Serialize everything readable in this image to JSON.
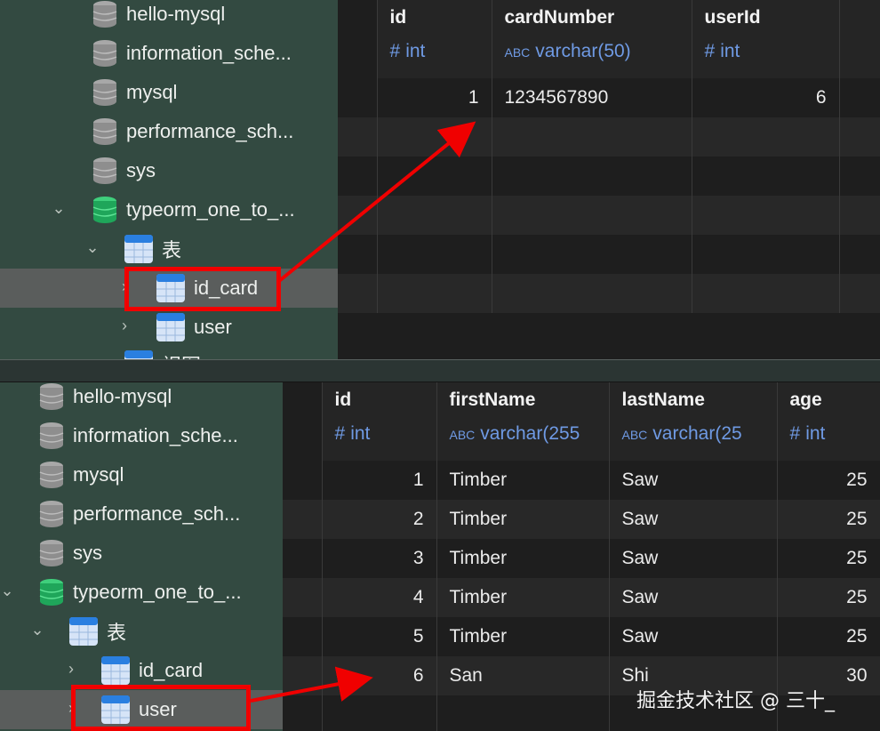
{
  "top": {
    "sidebar": {
      "databases": [
        {
          "name": "hello-mysql"
        },
        {
          "name": "information_sche..."
        },
        {
          "name": "mysql"
        },
        {
          "name": "performance_sch..."
        },
        {
          "name": "sys"
        },
        {
          "name": "typeorm_one_to_..."
        }
      ],
      "tables_folder": "表",
      "tables": [
        "id_card",
        "user"
      ],
      "views_folder": "视图",
      "selected": "id_card"
    },
    "grid": {
      "columns": [
        {
          "name": "id",
          "type": "int",
          "type_symbol": "#"
        },
        {
          "name": "cardNumber",
          "type": "varchar(50)",
          "type_symbol": "ABC"
        },
        {
          "name": "userId",
          "type": "int",
          "type_symbol": "#"
        }
      ],
      "rows": [
        [
          "1",
          "1234567890",
          "6"
        ]
      ]
    }
  },
  "bottom": {
    "sidebar": {
      "databases": [
        {
          "name": "hello-mysql"
        },
        {
          "name": "information_sche..."
        },
        {
          "name": "mysql"
        },
        {
          "name": "performance_sch..."
        },
        {
          "name": "sys"
        },
        {
          "name": "typeorm_one_to_..."
        }
      ],
      "tables_folder": "表",
      "tables": [
        "id_card",
        "user"
      ],
      "selected": "user"
    },
    "grid": {
      "columns": [
        {
          "name": "id",
          "type": "int",
          "type_symbol": "#"
        },
        {
          "name": "firstName",
          "type": "varchar(255",
          "type_symbol": "ABC"
        },
        {
          "name": "lastName",
          "type": "varchar(25",
          "type_symbol": "ABC"
        },
        {
          "name": "age",
          "type": "int",
          "type_symbol": "#"
        }
      ],
      "rows": [
        [
          "1",
          "Timber",
          "Saw",
          "25"
        ],
        [
          "2",
          "Timber",
          "Saw",
          "25"
        ],
        [
          "3",
          "Timber",
          "Saw",
          "25"
        ],
        [
          "4",
          "Timber",
          "Saw",
          "25"
        ],
        [
          "5",
          "Timber",
          "Saw",
          "25"
        ],
        [
          "6",
          "San",
          "Shi",
          "30"
        ]
      ]
    }
  },
  "watermark": "掘金技术社区 @ 三十_",
  "colors": {
    "annotation_red": "#f00000",
    "sidebar_bg": "#334a41",
    "type_blue": "#6f9ae4",
    "db_gray": "#9a9a9a",
    "db_green": "#1fa65a"
  }
}
